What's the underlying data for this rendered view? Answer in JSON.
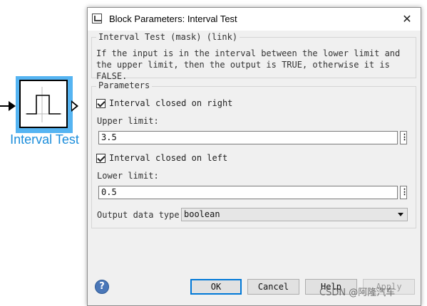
{
  "block": {
    "label": "Interval Test",
    "selection_color": "#55b4f2",
    "label_color": "#1b8ddb"
  },
  "dialog": {
    "title": "Block Parameters: Interval Test",
    "close_glyph": "✕",
    "mask_group_title": "Interval Test (mask) (link)",
    "description": "If the input is in the interval between the lower limit and the upper limit, then the output is TRUE, otherwise it is FALSE.",
    "params_group_title": "Parameters",
    "closed_right": {
      "label": "Interval closed on right",
      "checked": true
    },
    "upper_limit": {
      "label": "Upper limit:",
      "value": "3.5"
    },
    "closed_left": {
      "label": "Interval closed on left",
      "checked": true
    },
    "lower_limit": {
      "label": "Lower limit:",
      "value": "0.5"
    },
    "output_type": {
      "label": "Output data type:",
      "value": "boolean"
    },
    "dots_glyph": "⋮",
    "help_glyph": "?",
    "buttons": {
      "ok": "OK",
      "cancel": "Cancel",
      "help": "Help",
      "apply": "Apply"
    }
  },
  "watermark": "CSDN @阿隆汽车",
  "icons": [
    "block-parameters-icon",
    "close-icon",
    "help-icon",
    "dropdown-caret-icon",
    "interval-pulse-icon"
  ]
}
